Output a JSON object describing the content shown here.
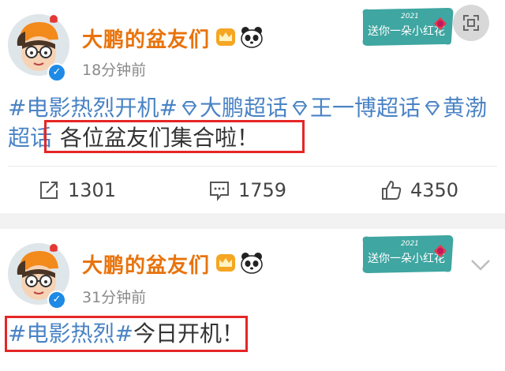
{
  "colors": {
    "username": "#e8730c",
    "link": "#4a83c4",
    "highlight_box": "#e52626",
    "verified_badge": "#1d8ae6",
    "badge_card": "#3fa6a1"
  },
  "posts": [
    {
      "username": "大鹏的盆友们",
      "timestamp": "18分钟前",
      "badge_text": "送你一朵小红花",
      "badge_year": "2021",
      "content": {
        "topic": "#电影热烈开机#",
        "super_topic_1": "大鹏超话",
        "super_topic_2": "王一博超话",
        "super_topic_3_line1": "黄渤",
        "super_topic_3_line2": "超话",
        "message": "各位盆友们集合啦！"
      },
      "actions": {
        "repost_count": "1301",
        "comment_count": "1759",
        "like_count": "4350"
      },
      "icons": [
        "crown-icon",
        "panda-icon",
        "verified-icon",
        "expand-icon",
        "repost-icon",
        "comment-icon",
        "like-icon"
      ]
    },
    {
      "username": "大鹏的盆友们",
      "timestamp": "31分钟前",
      "badge_text": "送你一朵小红花",
      "badge_year": "2021",
      "content": {
        "topic": "#电影热烈#",
        "message": "今日开机！"
      },
      "icons": [
        "crown-icon",
        "panda-icon",
        "verified-icon",
        "chevron-down-icon"
      ]
    }
  ]
}
